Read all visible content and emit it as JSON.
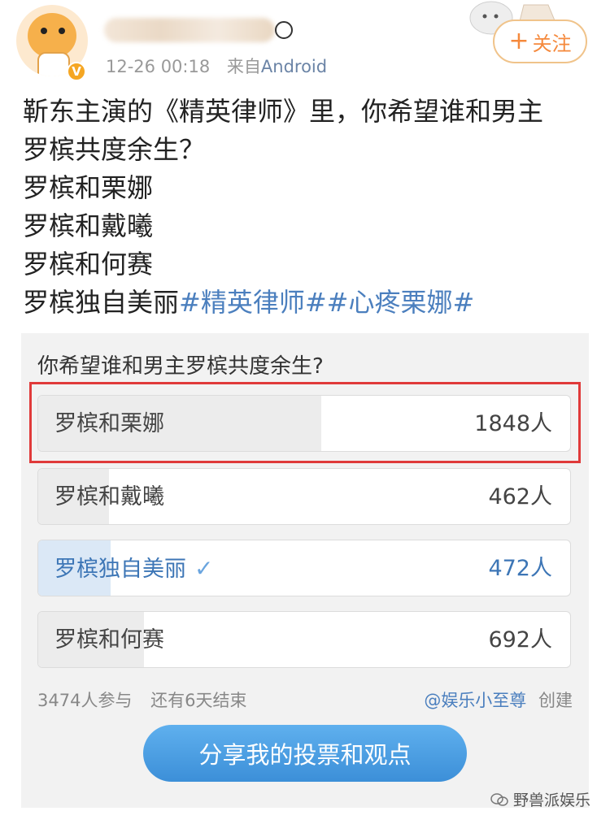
{
  "header": {
    "verified_badge": "V",
    "timestamp": "12-26 00:18",
    "source_prefix": "来自",
    "source": "Android",
    "follow_plus": "+",
    "follow_label": "关注"
  },
  "post": {
    "lines": [
      "靳东主演的《精英律师》里，你希望谁和男主",
      "罗槟共度余生？",
      "罗槟和栗娜",
      "罗槟和戴曦",
      "罗槟和何赛"
    ],
    "last_line_text": "罗槟独自美丽",
    "hashtag_1": "#精英律师#",
    "hashtag_2": "#心疼栗娜#"
  },
  "poll": {
    "question": "你希望谁和男主罗槟共度余生?",
    "options": [
      {
        "label": "罗槟和栗娜",
        "count": "1848人",
        "share": 0.532,
        "chosen": false
      },
      {
        "label": "罗槟和戴曦",
        "count": "462人",
        "share": 0.133,
        "chosen": false
      },
      {
        "label": "罗槟独自美丽",
        "count": "472人",
        "share": 0.136,
        "chosen": true
      },
      {
        "label": "罗槟和何赛",
        "count": "692人",
        "share": 0.199,
        "chosen": false
      }
    ],
    "check_mark": "✓",
    "participants": "3474人参与",
    "remaining": "还有6天结束",
    "creator": "@娱乐小至尊",
    "created_label": "创建",
    "share_button": "分享我的投票和观点"
  },
  "watermark": "野兽派娱乐",
  "colors": {
    "accent_blue": "#4b7fbe",
    "follow_orange": "#f5893c",
    "highlight_red": "#e03a3a",
    "share_blue": "#3c8fd8"
  }
}
